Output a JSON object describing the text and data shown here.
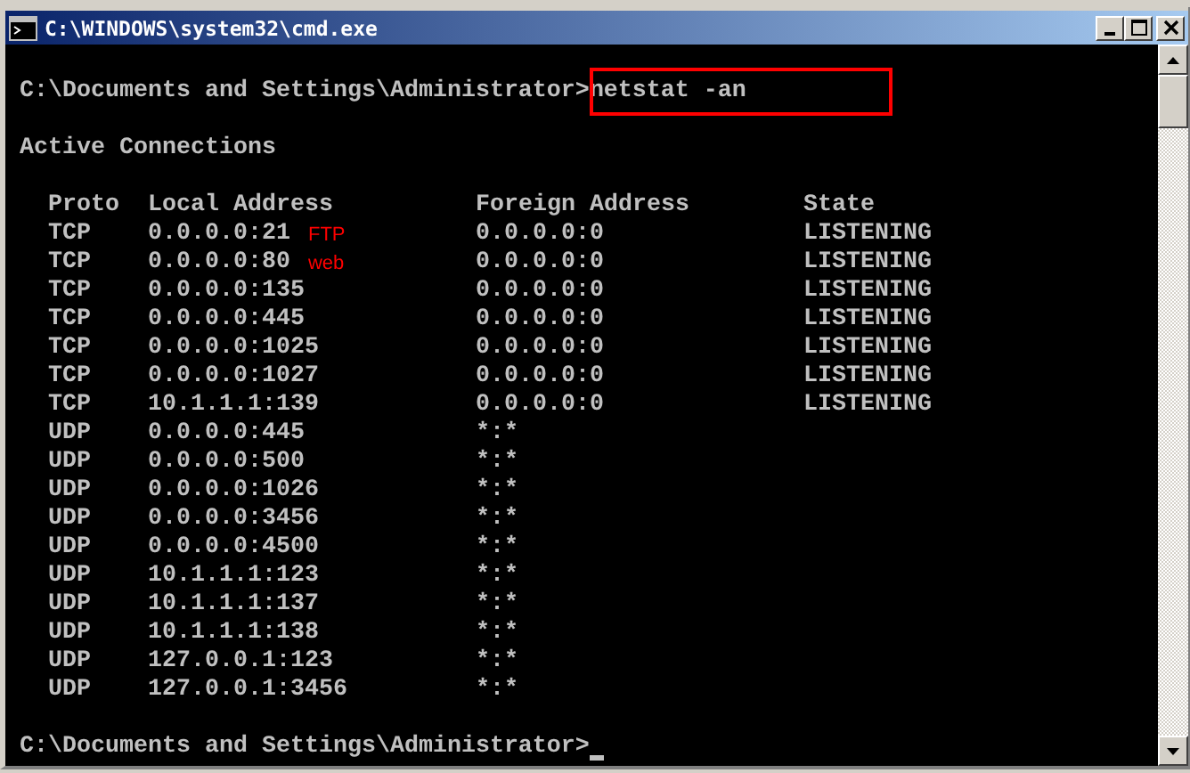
{
  "window": {
    "title": "C:\\WINDOWS\\system32\\cmd.exe"
  },
  "console": {
    "command_line": {
      "prompt": "C:\\Documents and Settings\\Administrator>",
      "command": "netstat -an",
      "highlighted": true
    },
    "heading": "Active Connections",
    "columns": [
      "Proto",
      "Local Address",
      "Foreign Address",
      "State"
    ],
    "rows": [
      {
        "proto": "TCP",
        "local": "0.0.0.0:21",
        "foreign": "0.0.0.0:0",
        "state": "LISTENING",
        "annotation": "FTP"
      },
      {
        "proto": "TCP",
        "local": "0.0.0.0:80",
        "foreign": "0.0.0.0:0",
        "state": "LISTENING",
        "annotation": "web"
      },
      {
        "proto": "TCP",
        "local": "0.0.0.0:135",
        "foreign": "0.0.0.0:0",
        "state": "LISTENING"
      },
      {
        "proto": "TCP",
        "local": "0.0.0.0:445",
        "foreign": "0.0.0.0:0",
        "state": "LISTENING"
      },
      {
        "proto": "TCP",
        "local": "0.0.0.0:1025",
        "foreign": "0.0.0.0:0",
        "state": "LISTENING"
      },
      {
        "proto": "TCP",
        "local": "0.0.0.0:1027",
        "foreign": "0.0.0.0:0",
        "state": "LISTENING"
      },
      {
        "proto": "TCP",
        "local": "10.1.1.1:139",
        "foreign": "0.0.0.0:0",
        "state": "LISTENING"
      },
      {
        "proto": "UDP",
        "local": "0.0.0.0:445",
        "foreign": "*:*"
      },
      {
        "proto": "UDP",
        "local": "0.0.0.0:500",
        "foreign": "*:*"
      },
      {
        "proto": "UDP",
        "local": "0.0.0.0:1026",
        "foreign": "*:*"
      },
      {
        "proto": "UDP",
        "local": "0.0.0.0:3456",
        "foreign": "*:*"
      },
      {
        "proto": "UDP",
        "local": "0.0.0.0:4500",
        "foreign": "*:*"
      },
      {
        "proto": "UDP",
        "local": "10.1.1.1:123",
        "foreign": "*:*"
      },
      {
        "proto": "UDP",
        "local": "10.1.1.1:137",
        "foreign": "*:*"
      },
      {
        "proto": "UDP",
        "local": "10.1.1.1:138",
        "foreign": "*:*"
      },
      {
        "proto": "UDP",
        "local": "127.0.0.1:123",
        "foreign": "*:*"
      },
      {
        "proto": "UDP",
        "local": "127.0.0.1:3456",
        "foreign": "*:*"
      }
    ],
    "final_prompt": "C:\\Documents and Settings\\Administrator>"
  }
}
